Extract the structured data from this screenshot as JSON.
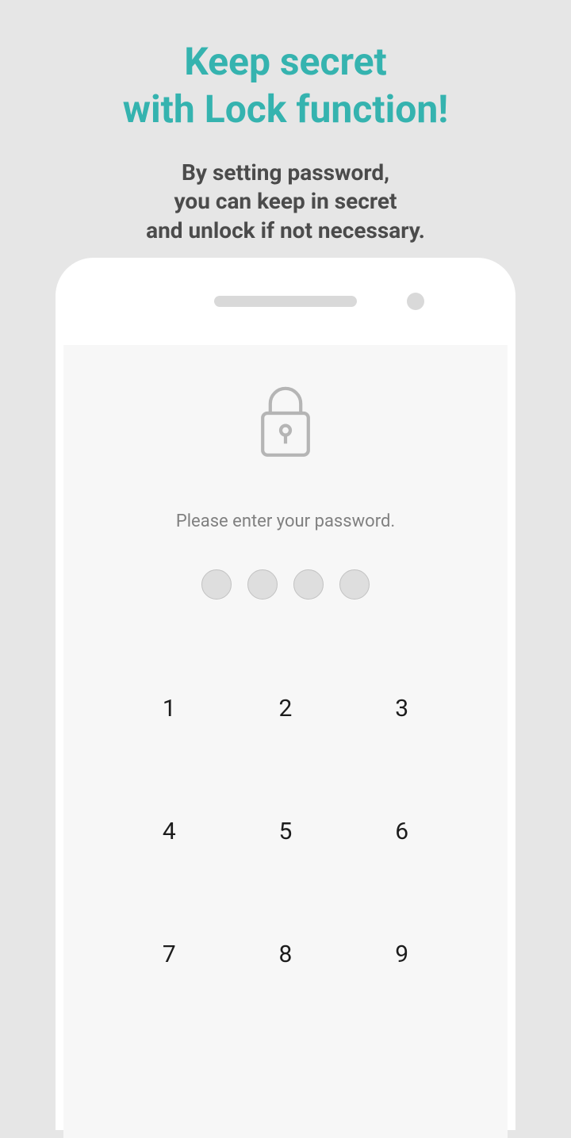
{
  "headline": {
    "line1": "Keep secret",
    "line2": "with Lock function!"
  },
  "subheadline": {
    "line1": "By setting password,",
    "line2": "you can keep in secret",
    "line3": "and unlock if not necessary."
  },
  "lockScreen": {
    "prompt": "Please enter your password.",
    "keypad": {
      "k1": "1",
      "k2": "2",
      "k3": "3",
      "k4": "4",
      "k5": "5",
      "k6": "6",
      "k7": "7",
      "k8": "8",
      "k9": "9"
    }
  }
}
